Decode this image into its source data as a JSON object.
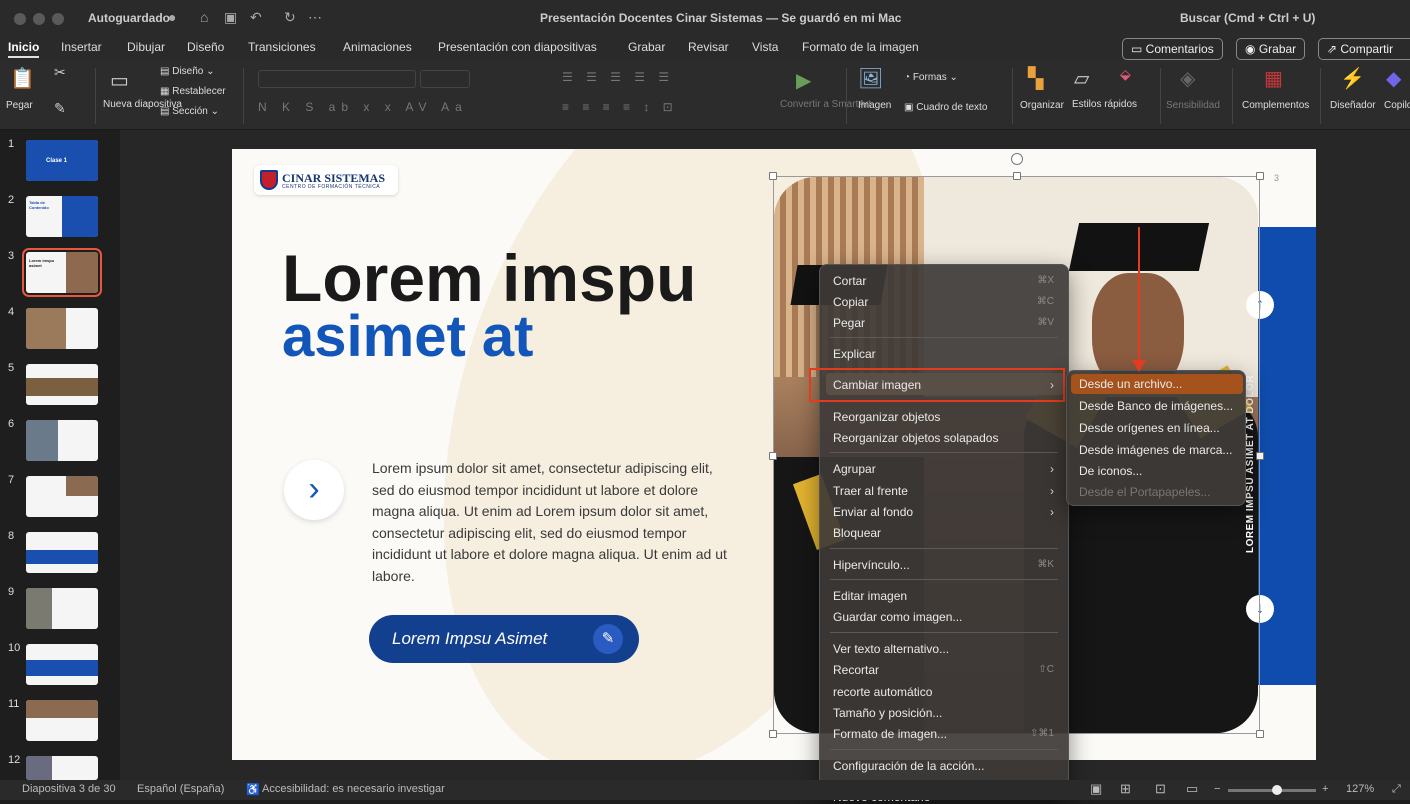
{
  "titlebar": {
    "autosave": "Autoguardado",
    "title": "Presentación Docentes Cinar Sistemas — Se guardó en mi Mac",
    "search": "Buscar (Cmd + Ctrl + U)"
  },
  "tabs": [
    "Inicio",
    "Insertar",
    "Dibujar",
    "Diseño",
    "Transiciones",
    "Animaciones",
    "Presentación con diapositivas",
    "Grabar",
    "Revisar",
    "Vista",
    "Formato de la imagen"
  ],
  "actions": {
    "comments": "Comentarios",
    "record": "Grabar",
    "share": "Compartir"
  },
  "ribbon": {
    "paste": "Pegar",
    "new_slide": "Nueva diapositiva",
    "layout": "Diseño",
    "reset": "Restablecer",
    "section": "Sección",
    "convert": "Convertir a SmartArt",
    "image": "Imagen",
    "shapes": "Formas",
    "textbox": "Cuadro de texto",
    "arrange": "Organizar",
    "quick_styles": "Estilos rápidos",
    "sensitivity": "Sensibilidad",
    "addins": "Complementos",
    "designer": "Diseñador",
    "copilot": "Copilo"
  },
  "thumbnails": {
    "items": [
      "1",
      "2",
      "3",
      "4",
      "5",
      "6",
      "7",
      "8",
      "9",
      "10",
      "11",
      "12"
    ],
    "t1": "Clase 1",
    "t2": "Tabla de Contenido",
    "t3": "Lorem imspu asimet"
  },
  "slide": {
    "logo_name": "CINAR SISTEMAS",
    "logo_sub": "CENTRO DE FORMACIÓN TÉCNICA",
    "heading1": "Lorem imspu",
    "heading2": "asimet at",
    "paragraph": "Lorem ipsum dolor sit amet, consectetur adipiscing elit, sed do eiusmod tempor incididunt ut labore et dolore magna aliqua. Ut enim ad Lorem ipsum dolor sit amet, consectetur adipiscing elit, sed do eiusmod tempor incididunt ut labore et dolore magna aliqua. Ut enim ad ut labore.",
    "cta": "Lorem Impsu Asimet",
    "page_number": "3",
    "vertical_text": "LOREM IMPSU ASIMET AT DOLOR"
  },
  "context_menu": {
    "cut": "Cortar",
    "cut_sc": "⌘X",
    "copy": "Copiar",
    "copy_sc": "⌘C",
    "paste": "Pegar",
    "paste_sc": "⌘V",
    "explain": "Explicar",
    "change_image": "Cambiar imagen",
    "reorganize": "Reorganizar objetos",
    "reorganize_overlap": "Reorganizar objetos solapados",
    "group": "Agrupar",
    "bring_front": "Traer al frente",
    "send_back": "Enviar al fondo",
    "lock": "Bloquear",
    "hyperlink": "Hipervínculo...",
    "hyperlink_sc": "⌘K",
    "edit_image": "Editar imagen",
    "save_image": "Guardar como imagen...",
    "alt_text": "Ver texto alternativo...",
    "crop": "Recortar",
    "crop_sc": "⇧C",
    "auto_crop": "recorte automático",
    "size_pos": "Tamaño y posición...",
    "format_image": "Formato de imagen...",
    "format_image_sc": "⇧⌘1",
    "action_settings": "Configuración de la acción...",
    "new_comment": "Nuevo comentario",
    "new_comment_sc": "⇧⌘M"
  },
  "submenu": {
    "from_file": "Desde un archivo...",
    "stock": "Desde Banco de imágenes...",
    "online": "Desde orígenes en línea...",
    "brand": "Desde imágenes de marca...",
    "icons": "De iconos...",
    "clipboard": "Desde el Portapapeles..."
  },
  "status": {
    "slide": "Diapositiva 3 de 30",
    "language": "Español (España)",
    "accessibility": "Accesibilidad: es necesario investigar",
    "zoom": "127%"
  }
}
